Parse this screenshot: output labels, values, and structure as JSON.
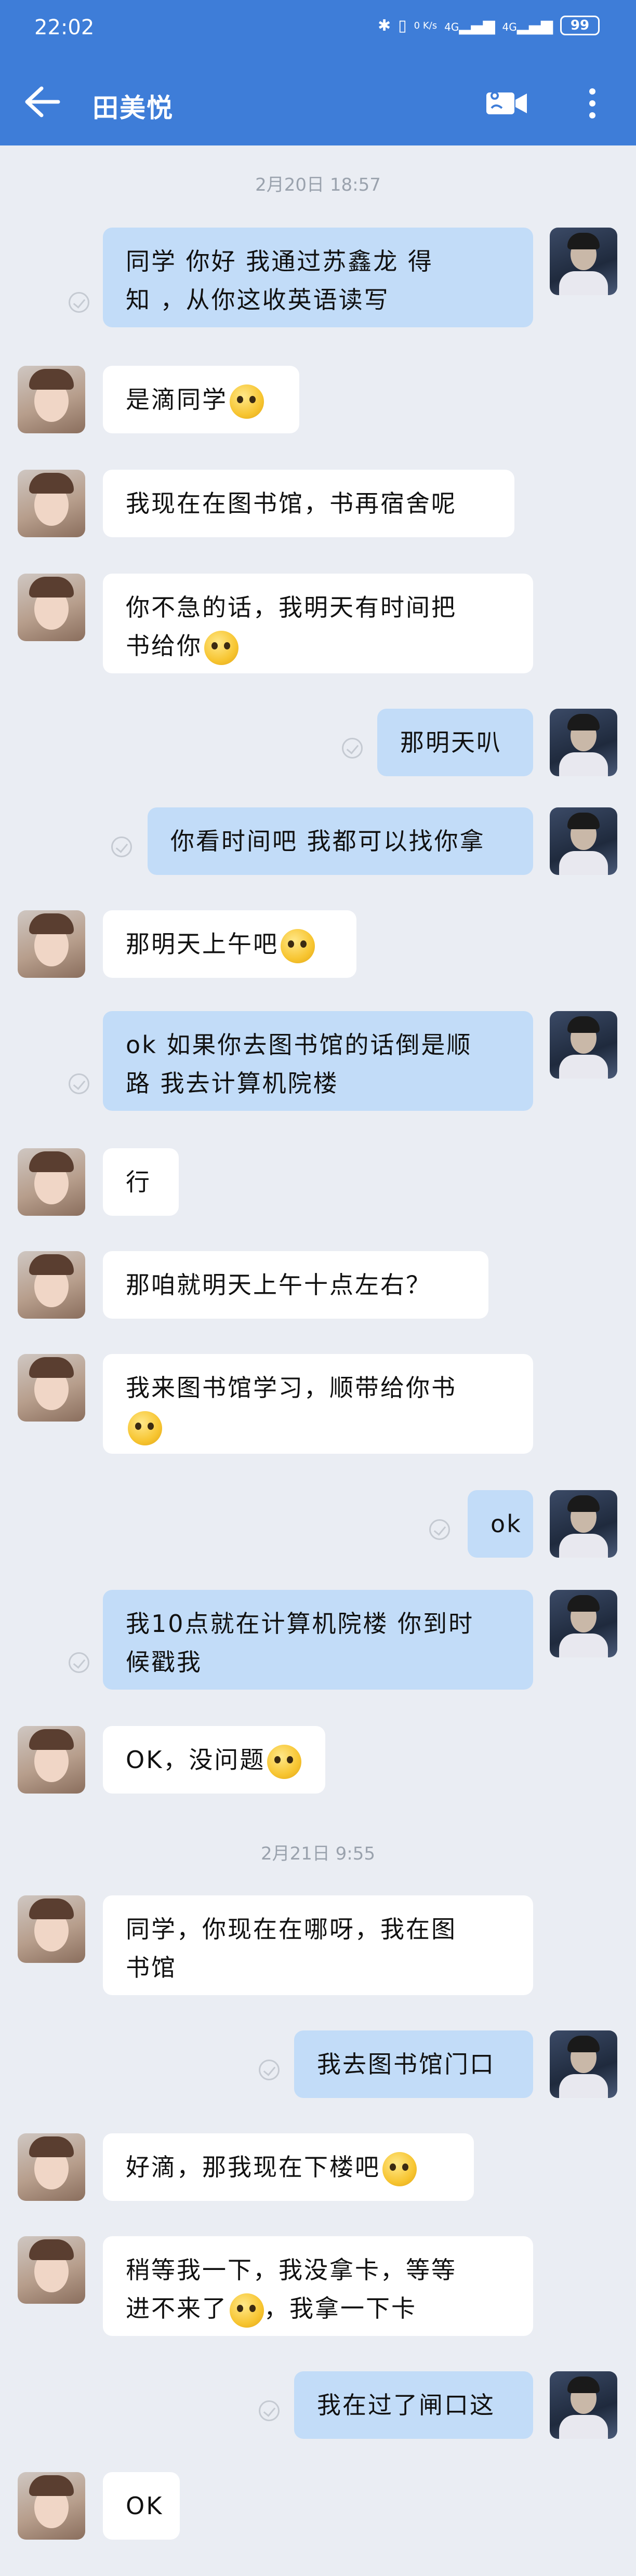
{
  "status": {
    "time": "22:02",
    "signal1": "4G",
    "signal2": "4G",
    "data_rate": "0 K/s",
    "battery": "99"
  },
  "header": {
    "title": "田美悦",
    "back_icon": "arrow-left-icon",
    "video_icon": "video-call-icon",
    "more_icon": "more-vertical-icon"
  },
  "colors": {
    "header": "#3e7dd8",
    "background": "#eaedf3",
    "bubble_sent": "#c2dcf8",
    "bubble_received": "#ffffff"
  },
  "dates": [
    "2月20日 18:57",
    "2月21日 9:55"
  ],
  "messages": [
    {
      "side": "right",
      "text": "同学 你好 我通过苏鑫龙 得\n知 ，从你这收英语读写"
    },
    {
      "side": "left",
      "text": "是滴同学",
      "emoji": "slightly-smiling-face-emoji"
    },
    {
      "side": "left",
      "text": "我现在在图书馆，书再宿舍呢"
    },
    {
      "side": "left",
      "text": "你不急的话，我明天有时间把\n书给你",
      "emoji": "slightly-smiling-face-emoji"
    },
    {
      "side": "right",
      "text": "那明天叭"
    },
    {
      "side": "right",
      "text": "你看时间吧 我都可以找你拿"
    },
    {
      "side": "left",
      "text": "那明天上午吧",
      "emoji": "slightly-smiling-face-emoji"
    },
    {
      "side": "right",
      "text": "ok 如果你去图书馆的话倒是顺\n路 我去计算机院楼"
    },
    {
      "side": "left",
      "text": "行"
    },
    {
      "side": "left",
      "text": "那咱就明天上午十点左右？"
    },
    {
      "side": "left",
      "text": "我来图书馆学习，顺带给你书\n",
      "emoji": "slightly-smiling-face-emoji"
    },
    {
      "side": "right",
      "text": "ok"
    },
    {
      "side": "right",
      "text": "我10点就在计算机院楼 你到时\n候戳我"
    },
    {
      "side": "left",
      "text": "OK，没问题",
      "emoji": "ok-hand-emoji"
    },
    {
      "side": "left",
      "text": "同学，你现在在哪呀，我在图\n书馆"
    },
    {
      "side": "right",
      "text": "我去图书馆门口"
    },
    {
      "side": "left",
      "text": "好滴，那我现在下楼吧",
      "emoji": "slightly-smiling-face-emoji"
    },
    {
      "side": "left",
      "text": "稍等我一下，我没拿卡，等等\n进不来了",
      "emoji": "crying-face-emoji",
      "text_after": "，我拿一下卡"
    },
    {
      "side": "right",
      "text": "我在过了闸口这"
    },
    {
      "side": "left",
      "text": "OK"
    }
  ]
}
